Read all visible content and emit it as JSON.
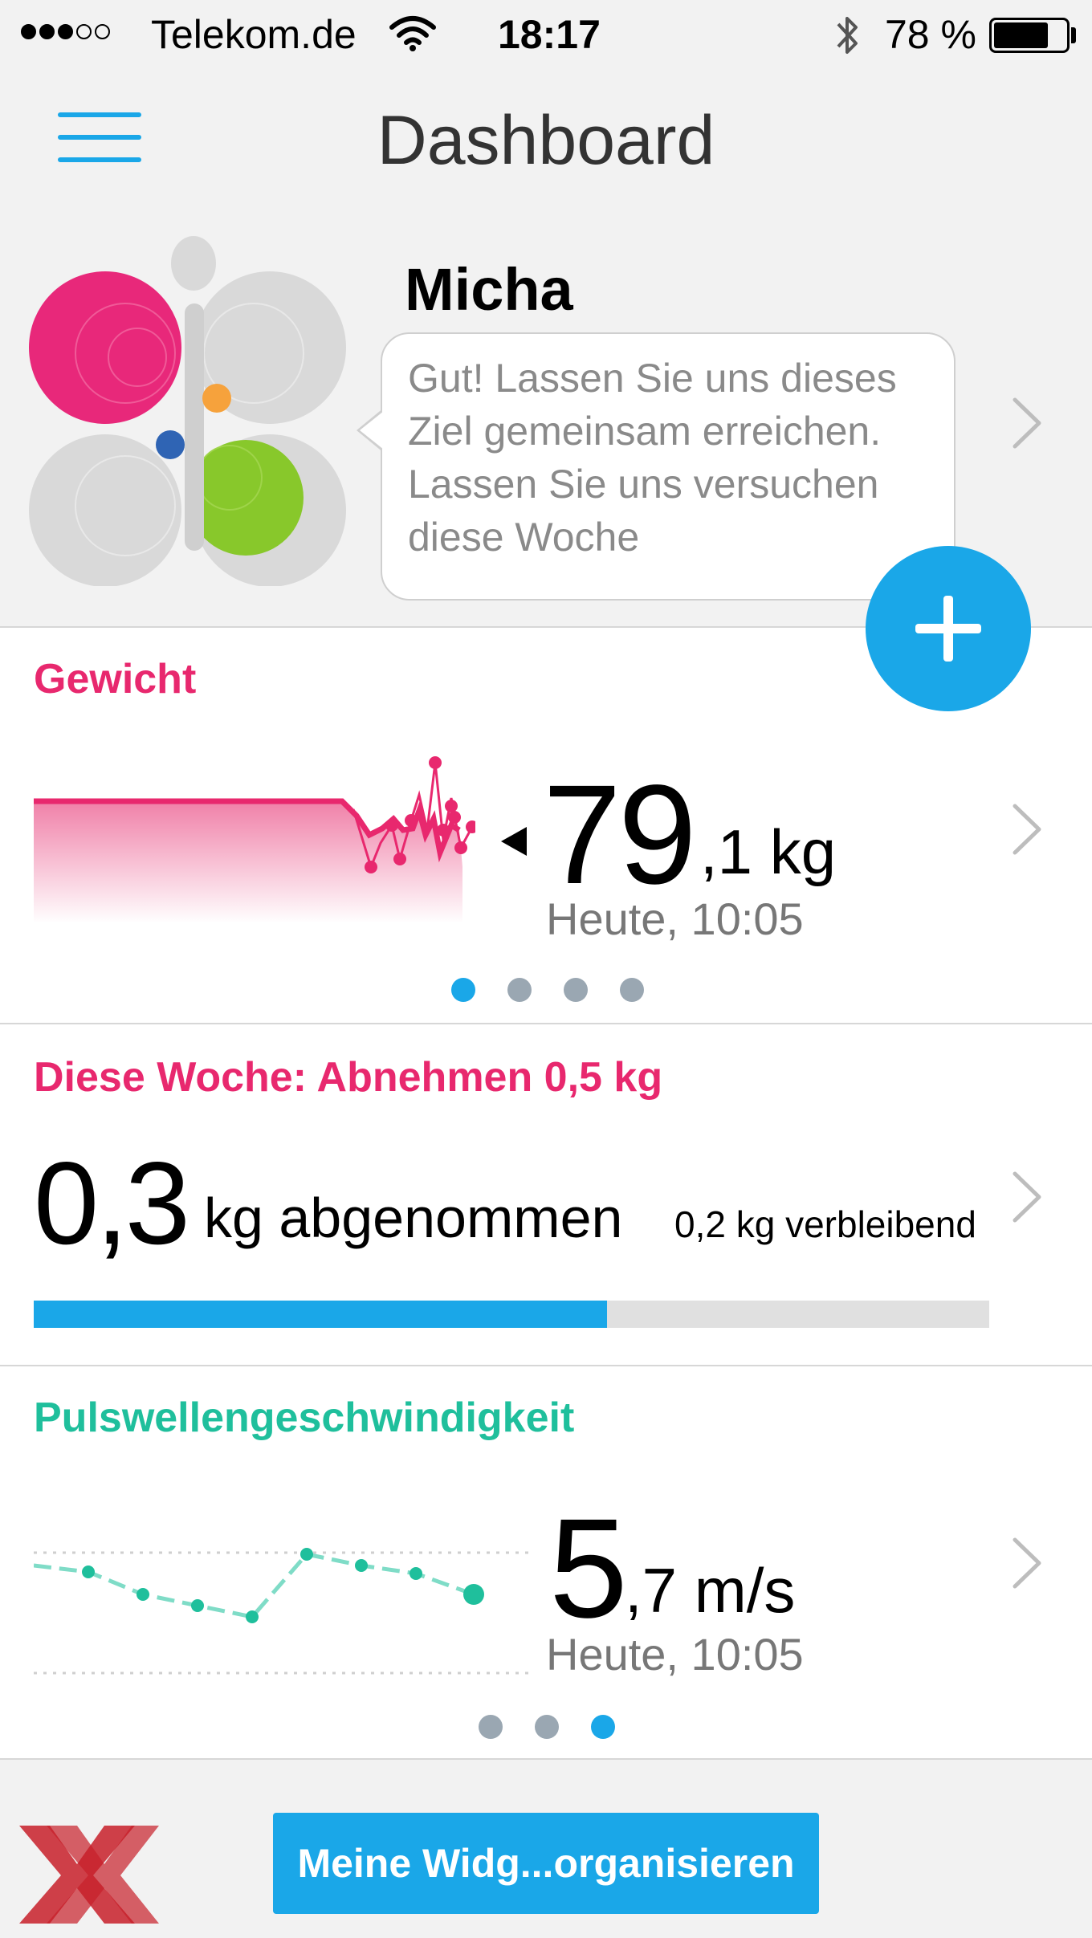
{
  "status_bar": {
    "carrier": "Telekom.de",
    "time": "18:17",
    "battery_percent": "78 %",
    "battery_level": 0.78,
    "signal_bars_filled": 3,
    "signal_bars_total": 5
  },
  "header": {
    "title": "Dashboard"
  },
  "profile": {
    "name": "Micha",
    "message": "Gut! Lassen Sie uns dieses Ziel gemeinsam erreichen. Lassen Sie uns versuchen diese Woche"
  },
  "weight_card": {
    "title": "Gewicht",
    "value_int": "79",
    "value_rest": ",1 kg",
    "timestamp": "Heute, 10:05",
    "page_count": 4,
    "active_page": 0
  },
  "goal_card": {
    "title": "Diese Woche: Abnehmen 0,5 kg",
    "value": "0,3",
    "label": "kg abgenommen",
    "remaining": "0,2 kg verbleibend",
    "progress": 0.6
  },
  "pwv_card": {
    "title": "Pulswellengeschwindigkeit",
    "value_int": "5",
    "value_rest": ",7 m/s",
    "timestamp": "Heute, 10:05",
    "page_count": 3,
    "active_page": 2
  },
  "bottom": {
    "organize_button": "Meine Widg...organisieren"
  },
  "colors": {
    "accent": "#1aa7e8",
    "weight": "#e8286e",
    "pwv": "#1fbf9c"
  }
}
